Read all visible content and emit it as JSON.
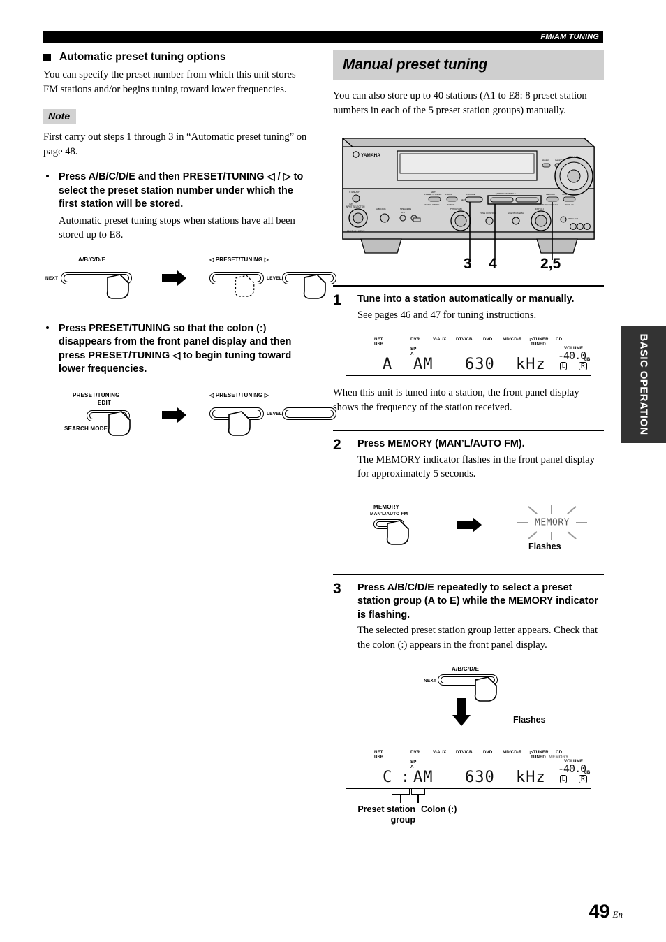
{
  "header": {
    "running_head": "FM/AM TUNING"
  },
  "left_column": {
    "section_heading": "Automatic preset tuning options",
    "intro_paragraph": "You can specify the preset number from which this unit stores FM stations and/or begins tuning toward lower frequencies.",
    "note_label": "Note",
    "note_text": "First carry out steps 1 through 3 in “Automatic preset tuning” on page 48.",
    "bullets": [
      {
        "head": "Press A/B/C/D/E and then PRESET/TUNING ◁ / ▷ to select the preset station number under which the first station will be stored.",
        "sub": "Automatic preset tuning stops when stations have all been stored up to E8.",
        "figure": {
          "left_label": "A/B/C/D/E",
          "left_button_tag": "NEXT",
          "right_label": "◁  PRESET/TUNING  ▷",
          "right_button_tag": "LEVEL"
        }
      },
      {
        "head": "Press PRESET/TUNING so that the colon (:) disappears from the front panel display and then press PRESET/TUNING ◁ to begin tuning toward lower frequencies.",
        "sub": "",
        "figure": {
          "left_label_line1": "PRESET/TUNING",
          "left_label_line2": "EDIT",
          "left_label_line3": "SEARCH MODE",
          "right_label": "◁  PRESET/TUNING  ▷",
          "right_button_tag": "LEVEL"
        }
      }
    ]
  },
  "right_column": {
    "title": "Manual preset tuning",
    "intro_paragraph": "You can also store up to 40 stations (A1 to E8: 8 preset station numbers in each of the 5 preset station groups) manually.",
    "receiver": {
      "brand": "YAMAHA",
      "callouts": [
        "3",
        "4",
        "2,5"
      ],
      "panel_labels": {
        "volume": "VOLUME",
        "preset_tuning": "PRESET/TUNING",
        "memory": "MEMORY",
        "input": "INPUT",
        "program": "PROGRAM"
      }
    },
    "steps": [
      {
        "number": "1",
        "head": "Tune into a station automatically or manually.",
        "sub": "See pages 46 and 47 for tuning instructions.",
        "after_text": "When this unit is tuned into a station, the front panel display shows the frequency of the station received."
      },
      {
        "number": "2",
        "head": "Press MEMORY (MAN’L/AUTO FM).",
        "sub": "The MEMORY indicator flashes in the front panel display for approximately 5 seconds.",
        "figure": {
          "button_label_line1": "MEMORY",
          "button_label_line2": "MAN'L/AUTO FM",
          "flash_word": "MEMORY",
          "flash_caption": "Flashes"
        }
      },
      {
        "number": "3",
        "head": "Press A/B/C/D/E repeatedly to select a preset station group (A to E) while the MEMORY indicator is flashing.",
        "sub": "The selected preset station group letter appears. Check that the colon (:) appears in the front panel display.",
        "figure": {
          "button_label": "A/B/C/D/E",
          "button_tag": "NEXT",
          "flash_caption": "Flashes"
        },
        "annotations": {
          "preset_group": "Preset station group",
          "colon": "Colon (:)"
        }
      }
    ],
    "lcd_top": {
      "indicators_row1": [
        "NET",
        "DVR",
        "V-AUX",
        "DTV/CBL",
        "DVD",
        "MD/CD-R",
        "▷TUNER",
        "CD"
      ],
      "net_second_line": "USB",
      "tuned_label": "TUNED",
      "sp_label": "SP",
      "sp_channel": "A",
      "volume_label": "VOLUME",
      "volume_value": "-40.0",
      "volume_unit": "dB",
      "main_text": "A    AM   630 kHz",
      "preset_letter": "A",
      "band": "AM",
      "frequency": "630",
      "frequency_unit": "kHz",
      "left_channel": "L",
      "right_channel": "R"
    },
    "lcd_bottom": {
      "indicators_row1": [
        "NET",
        "DVR",
        "V-AUX",
        "DTV/CBL",
        "DVD",
        "MD/CD-R",
        "▷TUNER",
        "CD"
      ],
      "net_second_line": "USB",
      "tuned_label": "TUNED",
      "memory_label": "MEMORY",
      "sp_label": "SP",
      "sp_channel": "A",
      "volume_label": "VOLUME",
      "volume_value": "-40.0",
      "volume_unit": "dB",
      "preset_letter": "C",
      "colon": ":",
      "band": "AM",
      "frequency": "630",
      "frequency_unit": "kHz",
      "left_channel": "L",
      "right_channel": "R"
    }
  },
  "side_tab": {
    "label": "BASIC OPERATION"
  },
  "footer": {
    "page_number": "49",
    "language": "En"
  }
}
